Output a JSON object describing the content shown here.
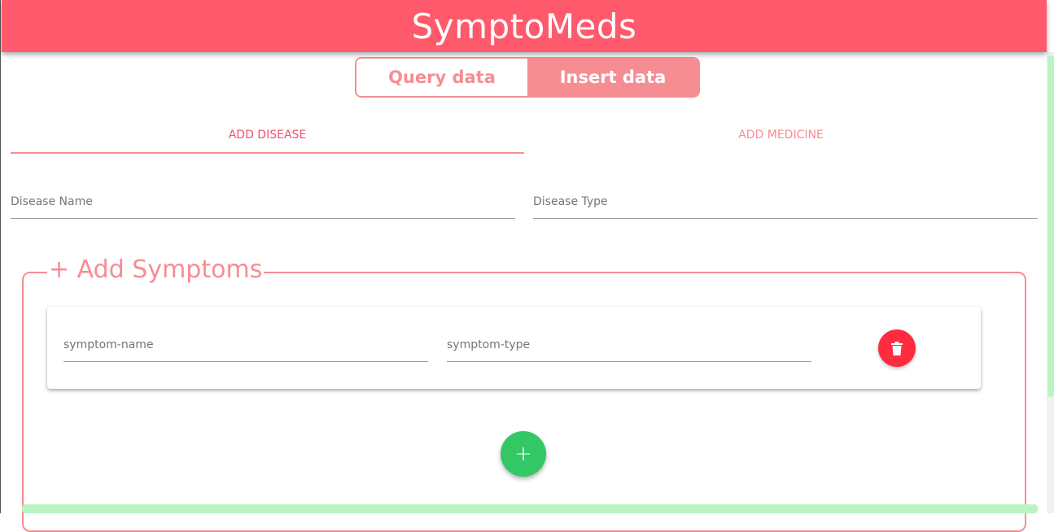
{
  "app": {
    "title": "SymptoMeds"
  },
  "mode_toggle": {
    "query_label": "Query data",
    "insert_label": "Insert data",
    "active": "insert"
  },
  "tabs": [
    {
      "label": "ADD DISEASE",
      "selected": true
    },
    {
      "label": "ADD MEDICINE",
      "selected": false
    }
  ],
  "disease_form": {
    "name_placeholder": "Disease Name",
    "type_placeholder": "Disease Type"
  },
  "symptoms": {
    "legend": "+ Add Symptoms",
    "name_placeholder": "symptom-name",
    "type_placeholder": "symptom-type",
    "delete_icon": "trash-icon",
    "add_icon": "plus-icon",
    "add_symbol": "+"
  },
  "colors": {
    "header": "#ff5a6c",
    "accent": "#f68d93",
    "delete": "#ff2b41",
    "add": "#34c765",
    "scrollbar": "#b9f5c3"
  }
}
